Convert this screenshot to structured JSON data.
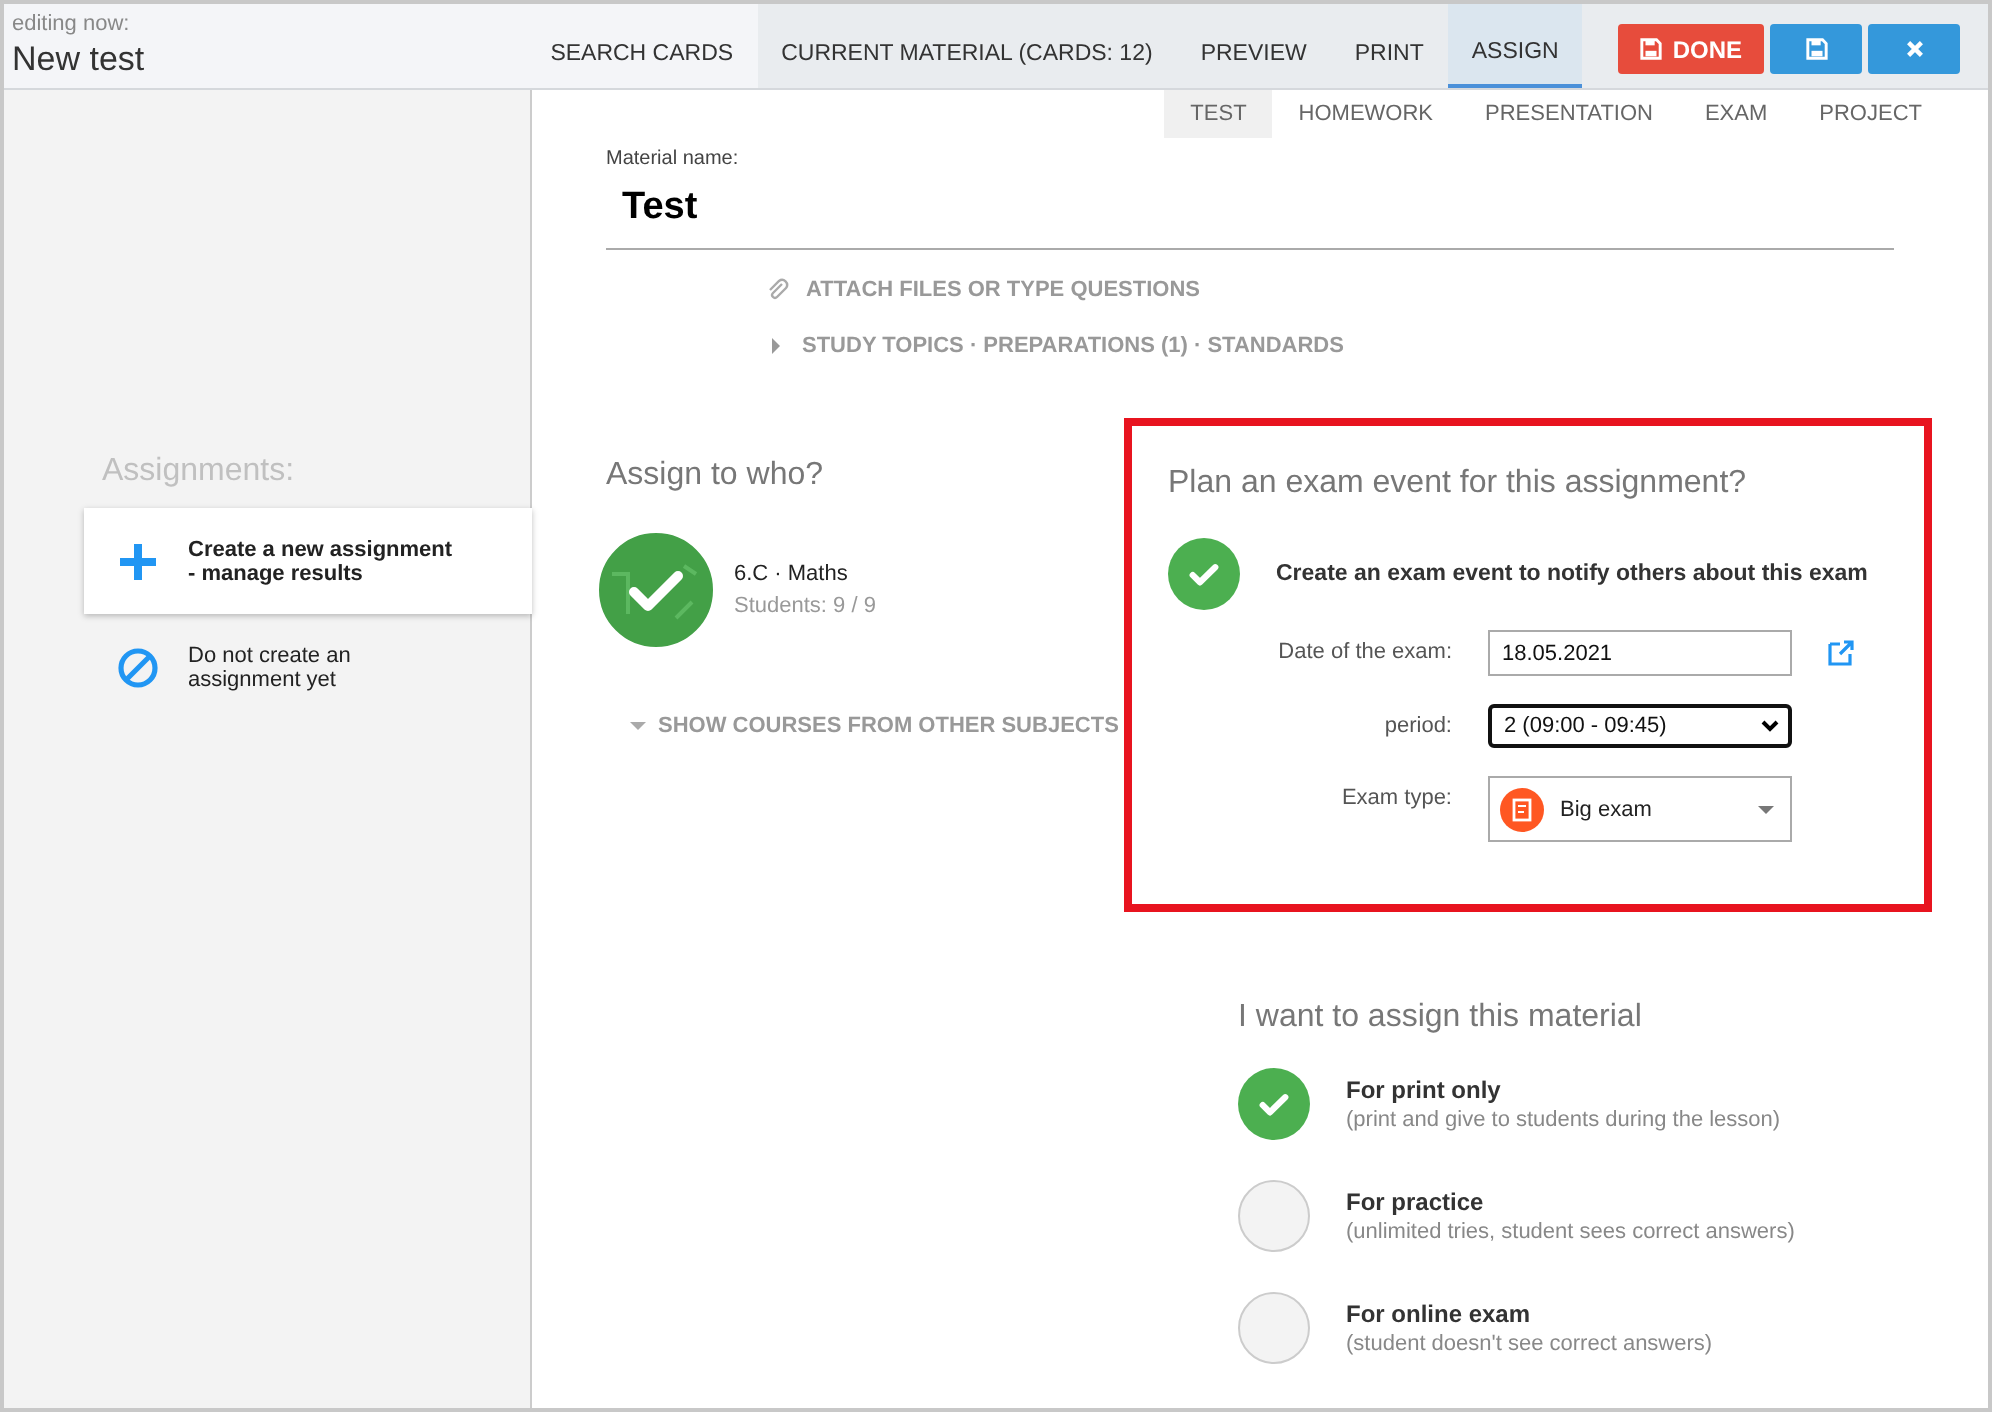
{
  "header": {
    "caption": "editing now:",
    "title": "New test"
  },
  "nav": [
    {
      "label": "SEARCH CARDS",
      "selected": false
    },
    {
      "label": "CURRENT MATERIAL (CARDS: 12)",
      "selected": false
    },
    {
      "label": "PREVIEW",
      "selected": false
    },
    {
      "label": "PRINT",
      "selected": false
    },
    {
      "label": "ASSIGN",
      "selected": true
    }
  ],
  "actions": [
    {
      "kind": "done",
      "label": "DONE"
    },
    {
      "kind": "save"
    },
    {
      "kind": "close"
    }
  ],
  "sub_tabs": [
    {
      "label": "TEST",
      "selected": true
    },
    {
      "label": "HOMEWORK",
      "selected": false
    },
    {
      "label": "PRESENTATION",
      "selected": false
    },
    {
      "label": "EXAM",
      "selected": false
    },
    {
      "label": "PROJECT",
      "selected": false
    }
  ],
  "material": {
    "label": "Material name:",
    "value": "Test"
  },
  "attach": {
    "label": "ATTACH FILES OR TYPE QUESTIONS"
  },
  "study_topics": {
    "label": "STUDY TOPICS · PREPARATIONS (1) · STANDARDS",
    "expanded": false
  },
  "sidebar": {
    "title": "Assignments:",
    "items": [
      {
        "kind": "add",
        "label": "Create a new assignment\n- manage results",
        "selected": true
      },
      {
        "kind": "none",
        "label": "Do not create an\nassignment yet",
        "selected": false
      }
    ]
  },
  "assign_to": {
    "title": "Assign to who?",
    "courses": [
      {
        "name": "6.C · Maths",
        "students": "Students: 9 / 9",
        "selected": true
      }
    ],
    "more": "SHOW COURSES FROM OTHER SUBJECTS"
  },
  "exam_event": {
    "title": "Plan an exam event for this assignment?",
    "checked": true,
    "label": "Create an exam event to notify others about this exam",
    "fields": [
      {
        "kind": "date",
        "label": "Date of the exam:",
        "value": "18.05.2021"
      },
      {
        "kind": "select",
        "label": "period:",
        "value": "2 (09:00 - 09:45)"
      },
      {
        "kind": "type",
        "label": "Exam type:",
        "value": "Big exam"
      }
    ]
  },
  "assign_mode": {
    "title": "I want to assign this material",
    "options": [
      {
        "title": "For print only",
        "note": "(print and give to students during the lesson)",
        "selected": true
      },
      {
        "title": "For practice",
        "note": "(unlimited tries, student sees correct answers)",
        "selected": false
      },
      {
        "title": "For online exam",
        "note": "(student doesn't see correct answers)",
        "selected": false
      }
    ]
  }
}
